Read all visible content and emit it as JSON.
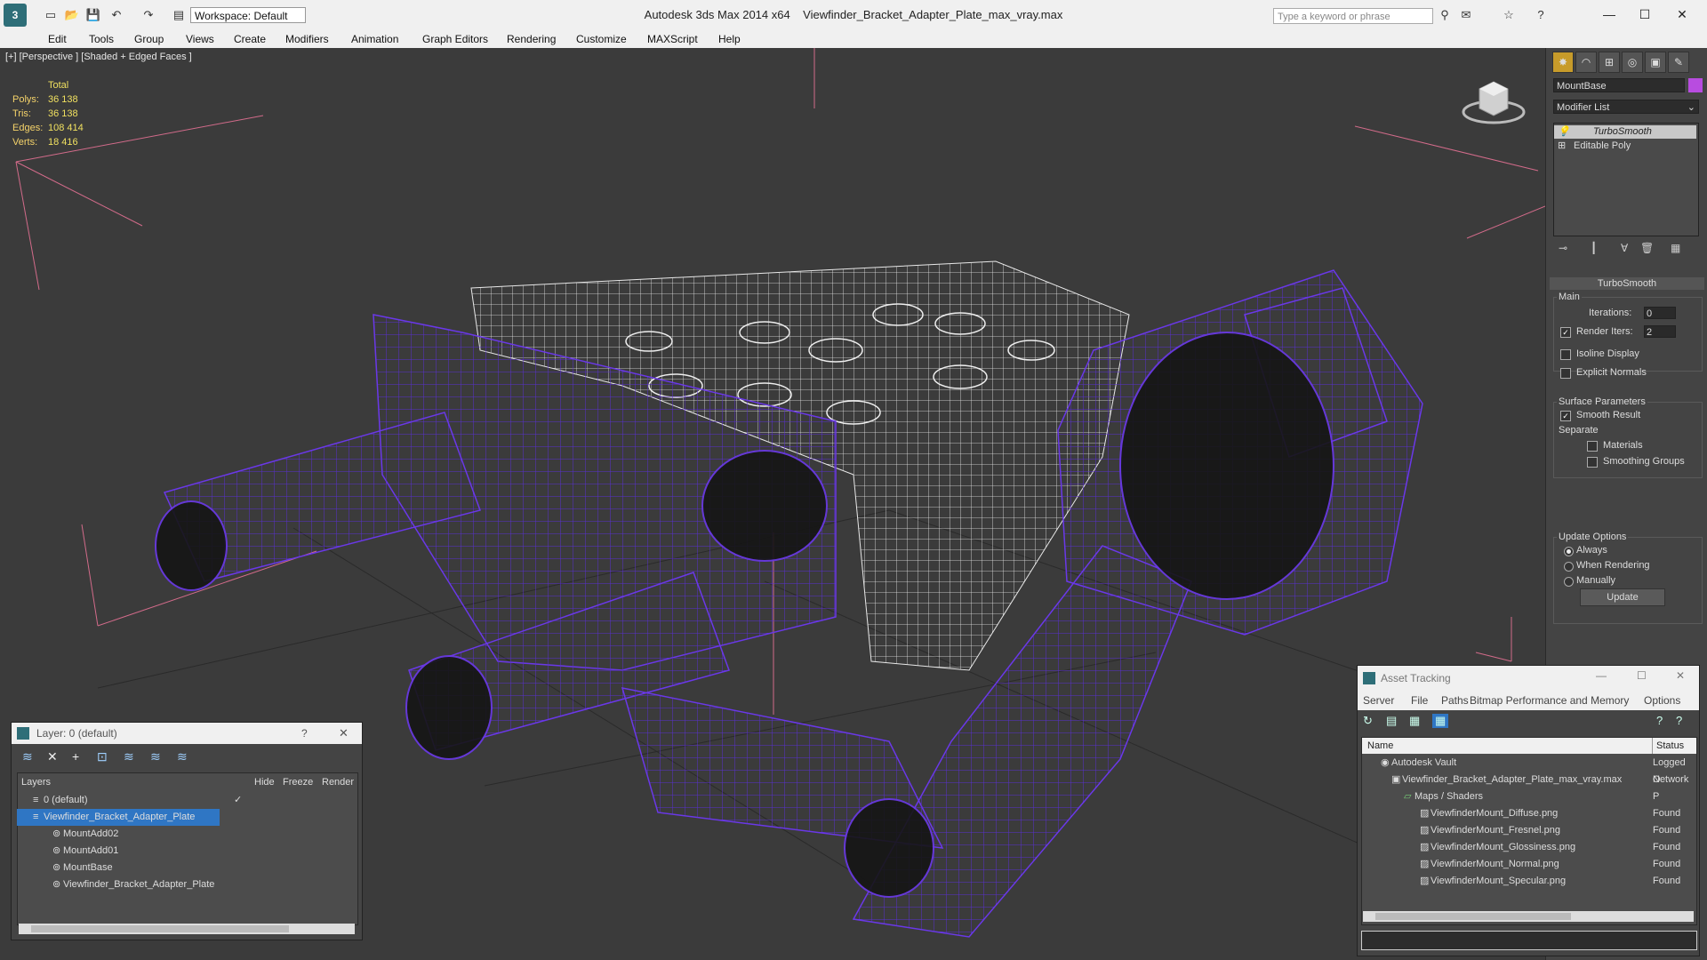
{
  "titlebar": {
    "app": "Autodesk 3ds Max  2014 x64",
    "file": "Viewfinder_Bracket_Adapter_Plate_max_vray.max",
    "workspace": "Workspace: Default",
    "search_placeholder": "Type a keyword or phrase"
  },
  "menu": [
    "Edit",
    "Tools",
    "Group",
    "Views",
    "Create",
    "Modifiers",
    "Animation",
    "Graph Editors",
    "Rendering",
    "Customize",
    "MAXScript",
    "Help"
  ],
  "viewport": {
    "label": "[+] [Perspective ] [Shaded + Edged Faces ]",
    "stats": {
      "header": "Total",
      "rows": [
        {
          "label": "Polys:",
          "value": "36 138"
        },
        {
          "label": "Tris:",
          "value": "36 138"
        },
        {
          "label": "Edges:",
          "value": "108 414"
        },
        {
          "label": "Verts:",
          "value": "18 416"
        }
      ]
    }
  },
  "command_panel": {
    "object_name": "MountBase",
    "modifier_list": "Modifier List",
    "stack": [
      "TurboSmooth",
      "Editable Poly"
    ],
    "rollout_title": "TurboSmooth",
    "main_label": "Main",
    "iterations_label": "Iterations:",
    "iterations_value": "0",
    "render_iters_label": "Render Iters:",
    "render_iters_value": "2",
    "isoline": "Isoline Display",
    "explicit_normals": "Explicit Normals",
    "surface_params": "Surface Parameters",
    "smooth_result": "Smooth Result",
    "separate": "Separate",
    "materials": "Materials",
    "smoothing_groups": "Smoothing Groups",
    "update_options": "Update Options",
    "always": "Always",
    "when_rendering": "When Rendering",
    "manually": "Manually",
    "update_btn": "Update"
  },
  "layer_dialog": {
    "title": "Layer: 0 (default)",
    "help": "?",
    "col_layers": "Layers",
    "col_hide": "Hide",
    "col_freeze": "Freeze",
    "col_render": "Render",
    "rows": [
      {
        "name": "0 (default)"
      },
      {
        "name": "Viewfinder_Bracket_Adapter_Plate"
      },
      {
        "name": "MountAdd02"
      },
      {
        "name": "MountAdd01"
      },
      {
        "name": "MountBase"
      },
      {
        "name": "Viewfinder_Bracket_Adapter_Plate"
      }
    ]
  },
  "asset_dialog": {
    "title": "Asset Tracking",
    "menu": [
      "Server",
      "File",
      "Paths",
      "Bitmap Performance and Memory",
      "Options"
    ],
    "col_name": "Name",
    "col_status": "Status",
    "rows": [
      {
        "name": "Autodesk Vault",
        "status": "Logged O"
      },
      {
        "name": "Viewfinder_Bracket_Adapter_Plate_max_vray.max",
        "status": "Network P"
      },
      {
        "name": "Maps / Shaders",
        "status": ""
      },
      {
        "name": "ViewfinderMount_Diffuse.png",
        "status": "Found"
      },
      {
        "name": "ViewfinderMount_Fresnel.png",
        "status": "Found"
      },
      {
        "name": "ViewfinderMount_Glossiness.png",
        "status": "Found"
      },
      {
        "name": "ViewfinderMount_Normal.png",
        "status": "Found"
      },
      {
        "name": "ViewfinderMount_Specular.png",
        "status": "Found"
      }
    ]
  }
}
